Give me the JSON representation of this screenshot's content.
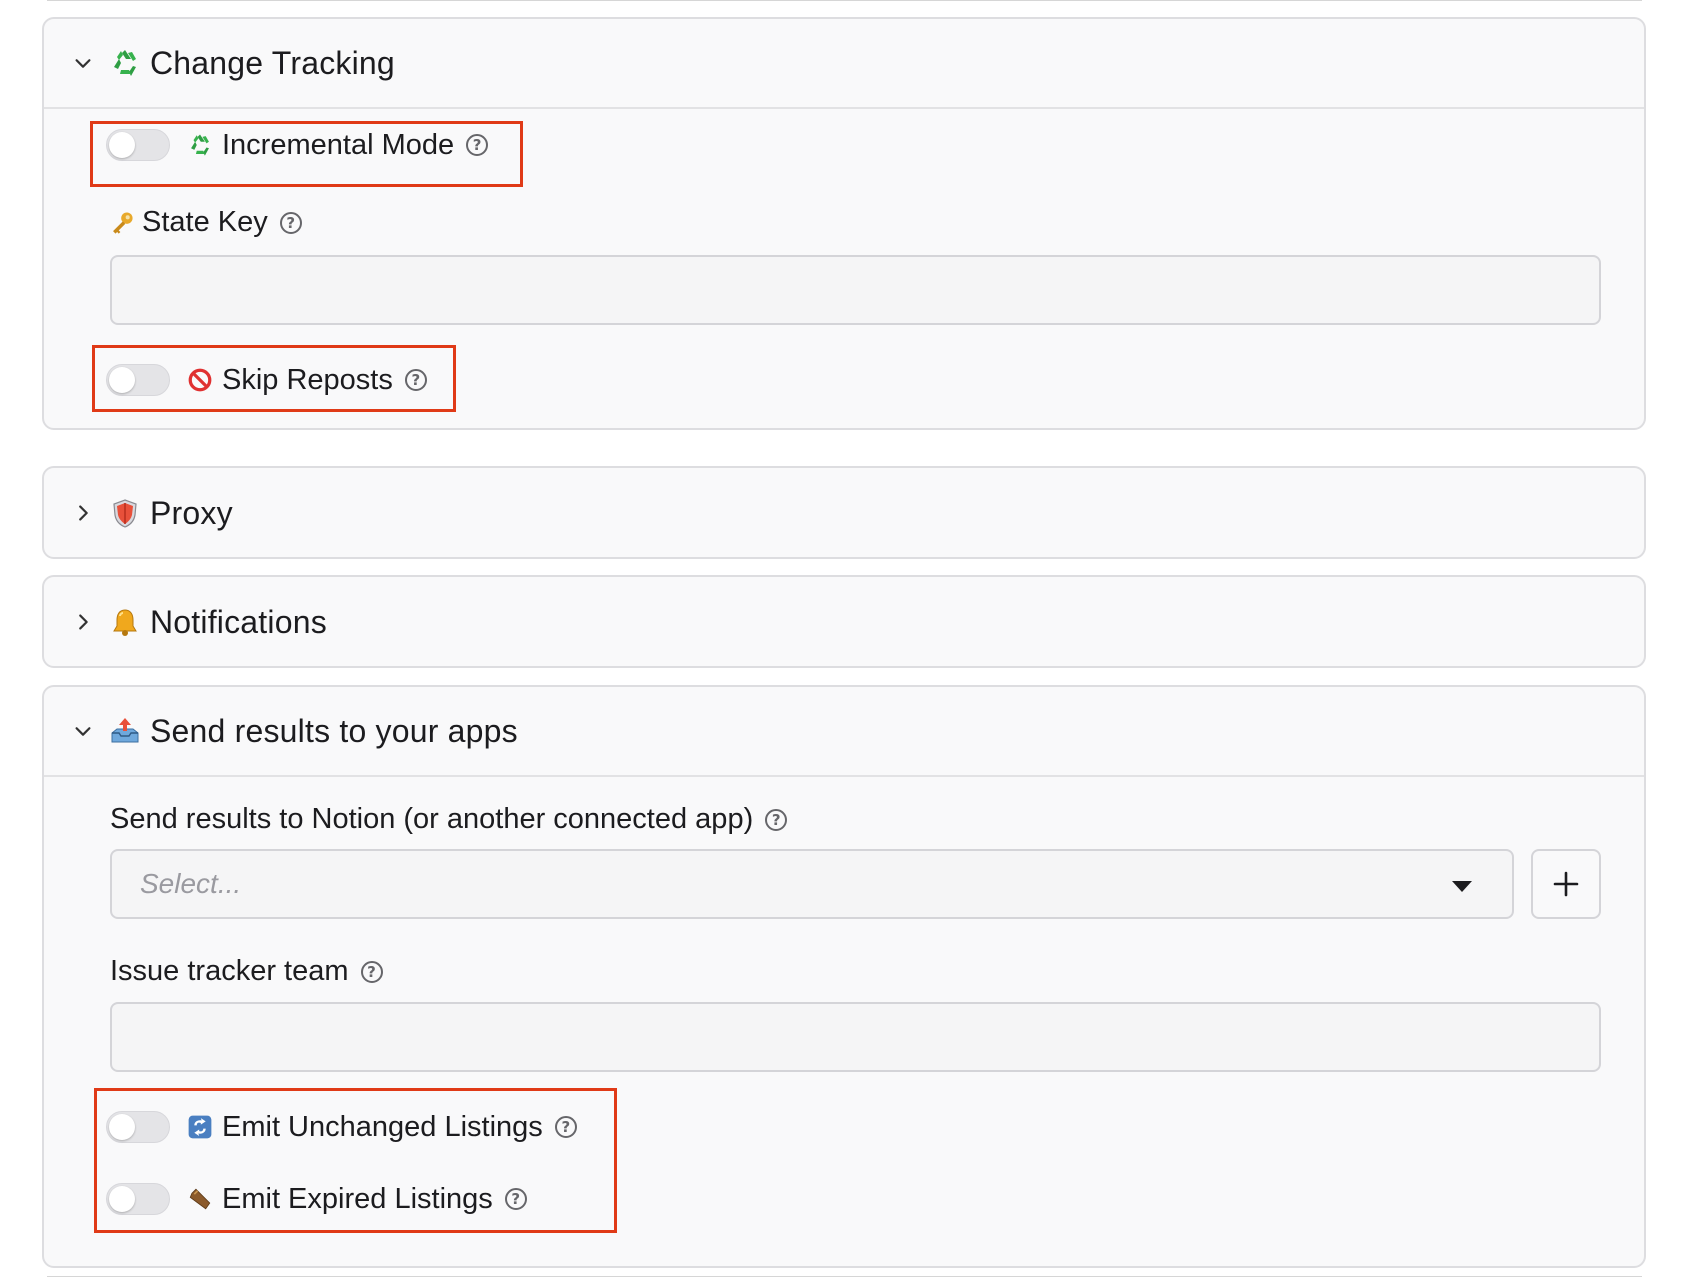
{
  "sections": {
    "change_tracking": {
      "title": "Change Tracking",
      "emoji": "recycle-icon",
      "expanded": true,
      "incremental_mode": {
        "label": "Incremental Mode",
        "enabled": false,
        "emoji": "recycle-icon"
      },
      "state_key": {
        "label": "State Key",
        "value": "",
        "emoji": "key-icon"
      },
      "skip_reposts": {
        "label": "Skip Reposts",
        "enabled": false,
        "emoji": "no-entry-icon"
      }
    },
    "proxy": {
      "title": "Proxy",
      "emoji": "shield-icon",
      "expanded": false
    },
    "notifications": {
      "title": "Notifications",
      "emoji": "bell-icon",
      "expanded": false
    },
    "send_results": {
      "title": "Send results to your apps",
      "emoji": "outbox-tray-icon",
      "expanded": true,
      "notion_app": {
        "label": "Send results to Notion (or another connected app)",
        "placeholder": "Select..."
      },
      "issue_tracker_team": {
        "label": "Issue tracker team",
        "value": ""
      },
      "emit_unchanged": {
        "label": "Emit Unchanged Listings",
        "enabled": false,
        "emoji": "arrows-counterclockwise-icon"
      },
      "emit_expired": {
        "label": "Emit Expired Listings",
        "enabled": false,
        "emoji": "coffin-icon"
      }
    }
  },
  "help_glyph": "?",
  "colors": {
    "highlight": "#e03a17",
    "toggle_off": "#e4e4e7",
    "section_bg": "#f9f9fa",
    "border": "#dddde0"
  }
}
